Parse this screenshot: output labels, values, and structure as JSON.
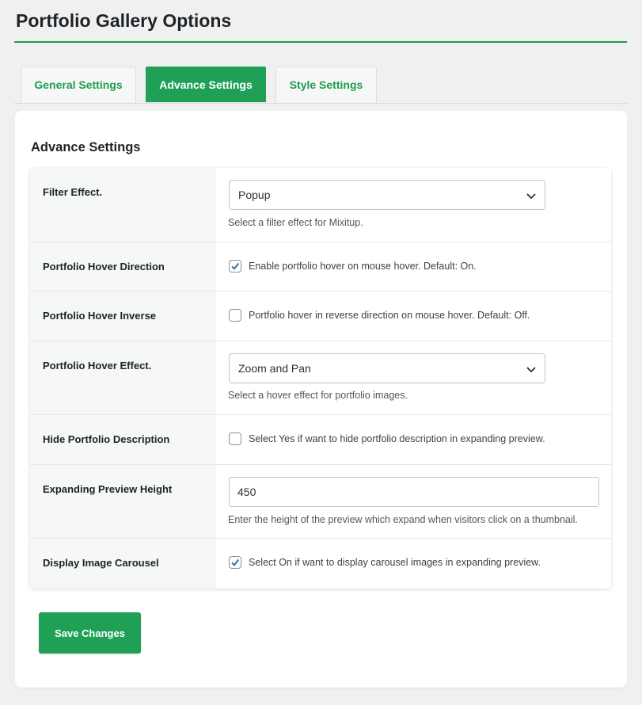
{
  "page": {
    "title": "Portfolio Gallery Options"
  },
  "tabs": [
    {
      "label": "General Settings",
      "active": false
    },
    {
      "label": "Advance Settings",
      "active": true
    },
    {
      "label": "Style Settings",
      "active": false
    }
  ],
  "section": {
    "title": "Advance Settings"
  },
  "settings": {
    "filter_effect": {
      "label": "Filter Effect.",
      "value": "Popup",
      "description": "Select a filter effect for Mixitup."
    },
    "hover_direction": {
      "label": "Portfolio Hover Direction",
      "checked": true,
      "text": "Enable portfolio hover on mouse hover. Default: On."
    },
    "hover_inverse": {
      "label": "Portfolio Hover Inverse",
      "checked": false,
      "text": "Portfolio hover in reverse direction on mouse hover. Default: Off."
    },
    "hover_effect": {
      "label": "Portfolio Hover Effect.",
      "value": "Zoom and Pan",
      "description": "Select a hover effect for portfolio images."
    },
    "hide_description": {
      "label": "Hide Portfolio Description",
      "checked": false,
      "text": "Select Yes if want to hide portfolio description in expanding preview."
    },
    "preview_height": {
      "label": "Expanding Preview Height",
      "value": "450",
      "description": "Enter the height of the preview which expand when visitors click on a thumbnail."
    },
    "image_carousel": {
      "label": "Display Image Carousel",
      "checked": true,
      "text": "Select On if want to display carousel images in expanding preview."
    }
  },
  "actions": {
    "save_label": "Save Changes"
  },
  "colors": {
    "accent": "#20a057",
    "accent_rule": "#1e9b4e",
    "checkbox_check": "#2271b1"
  },
  "icons": {
    "select_arrow": "chevron-down-icon",
    "checkbox_mark": "checkmark-icon"
  }
}
